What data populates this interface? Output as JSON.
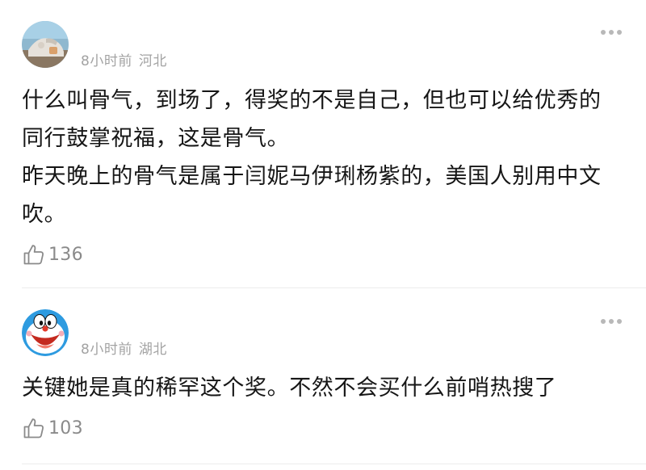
{
  "comments": [
    {
      "avatar_icon": "user-photo-avatar",
      "time": "8小时前",
      "location": "河北",
      "more_icon": "more-dots-icon",
      "paragraphs": [
        "什么叫骨气，到场了，得奖的不是自己，但也可以给优秀的同行鼓掌祝福，这是骨气。",
        "昨天晚上的骨气是属于闫妮马伊琍杨紫的，美国人别用中文吹。"
      ],
      "like_icon": "thumbs-up-icon",
      "likes": "136"
    },
    {
      "avatar_icon": "doraemon-avatar",
      "time": "8小时前",
      "location": "湖北",
      "more_icon": "more-dots-icon",
      "paragraphs": [
        "关键她是真的稀罕这个奖。不然不会买什么前哨热搜了"
      ],
      "like_icon": "thumbs-up-icon",
      "likes": "103"
    }
  ],
  "colors": {
    "meta": "#a3a3a3",
    "text": "#161616",
    "like": "#8a8a8a",
    "divider": "#ececec"
  }
}
